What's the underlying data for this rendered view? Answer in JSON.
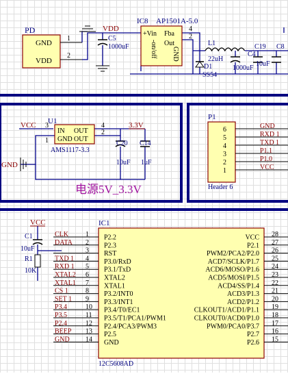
{
  "colors": {
    "wire": "#00008B",
    "body": "#FFFFB0",
    "body_stroke": "#8B0000",
    "ref": "#000080",
    "value": "#000080",
    "pin": "#000000",
    "net": "#8B0000",
    "title": "#A0129E"
  },
  "pd": {
    "ref": "PD",
    "pins": [
      "GND",
      "VDD"
    ],
    "pin_numbers": [
      "1",
      "2"
    ]
  },
  "ic8": {
    "ref": "IC8",
    "part": "AP1501A-5.0",
    "pins": [
      "+Vin",
      "Fba",
      "-on/off",
      "Out",
      "GND"
    ],
    "pin_numbers": [
      "4",
      "2"
    ]
  },
  "top_passives": {
    "vdd_label": "VDD",
    "c5": {
      "ref": "C5",
      "value": "1000uF"
    },
    "l1": {
      "ref": "L1",
      "value": "22uH"
    },
    "d1": {
      "ref": "D1",
      "value": "SS54"
    },
    "c4": {
      "ref": "C4",
      "value": "1000uF"
    },
    "c19": {
      "ref": "C19",
      "value": "10uF"
    },
    "c8": {
      "ref": "C8"
    }
  },
  "u1": {
    "ref": "U1",
    "part": "AMS1117-3.3",
    "pins": [
      "IN",
      "OUT",
      "GND",
      "OUT"
    ],
    "pin_numbers": [
      "3",
      "4",
      "1",
      "2"
    ],
    "vcc_label": "VCC",
    "v33_label": "3.3V",
    "gnd_label": "GND",
    "c20": {
      "ref": "C20",
      "value": "10uF"
    },
    "c14": {
      "ref": "C14",
      "value": "1uF"
    }
  },
  "power_title": "电源5V_3.3V",
  "p1": {
    "ref": "P1",
    "part": "Header 6",
    "pin_numbers": [
      "6",
      "5",
      "4",
      "3",
      "2",
      "1"
    ],
    "nets": [
      "GND",
      "RXD 1",
      "TXD 1",
      "P1.1",
      "P1.0",
      "VCC"
    ]
  },
  "reset": {
    "vcc_label": "VCC",
    "c1": {
      "ref": "C1",
      "value": "10uF"
    },
    "r1": {
      "ref": "R1",
      "value": "10K"
    }
  },
  "ic1": {
    "ref": "IC1",
    "part": "12C5608AD",
    "left_nets": [
      "CLK",
      "DATA",
      "",
      "TXD 1",
      "RXD 1",
      "XTAL2",
      "XTAL1",
      "CS 1",
      "SET 1",
      "P3.4",
      "P3.5",
      "P2.4",
      "BEEP",
      "GND"
    ],
    "left_numbers": [
      "1",
      "2",
      "3",
      "4",
      "5",
      "6",
      "7",
      "8",
      "9",
      "10",
      "11",
      "12",
      "13",
      "14"
    ],
    "left_pins": [
      "P2.2",
      "P2.3",
      "RST",
      "P3.0/RxD",
      "P3.1/TxD",
      "XTAL2",
      "XTAL1",
      "P3.2/INT0",
      "P3.3/INT1",
      "P3.4/T0/EC1",
      "P3.5/T1/PCA1/PWM1",
      "P2.4/PCA3/PWM3",
      "P2.5",
      "GND"
    ],
    "right_pins": [
      "VCC",
      "P2.1",
      "PWM2/PCA2/P2.0",
      "ACD7/SCLK/P1.7",
      "ACD6/MOSO/P1.6",
      "ACD5/MOSI/P1.5",
      "ACD4/SS/P1.4",
      "ACD3/P1.3",
      "ACD2/P1.2",
      "CLKOUT1/ACD1/P1.1",
      "CLKOUT0/ACD0/P1.0",
      "PWM0/PCA0/P3.7",
      "P2.7",
      "P2.6"
    ],
    "right_numbers": [
      "28",
      "27",
      "26",
      "25",
      "24",
      "23",
      "22",
      "21",
      "20",
      "19",
      "18",
      "17",
      "16",
      "15"
    ]
  }
}
